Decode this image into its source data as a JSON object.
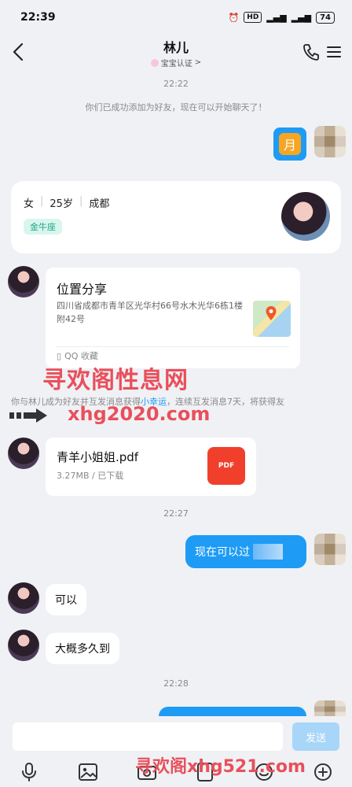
{
  "status_bar": {
    "time": "22:39",
    "battery": "74",
    "hd": "HD"
  },
  "header": {
    "title": "林儿",
    "subtitle": "宝宝认证",
    "subtitle_chevron": ">"
  },
  "timestamps": [
    "22:22",
    "22:27",
    "22:28"
  ],
  "system_messages": {
    "added_friend": "你们已成功添加为好友，现在可以开始聊天了！",
    "lucky_prefix": "你与林儿成为好友并互发消息获得",
    "lucky_link": "小幸运",
    "lucky_suffix": "，连续互发消息7天，将获得友"
  },
  "messages": {
    "emoji_label": "月",
    "mine_1": "现在可以过",
    "her_1": "可以",
    "her_2": "大概多久到"
  },
  "profile_card": {
    "gender": "女",
    "age": "25岁",
    "city": "成都",
    "zodiac_tag": "金牛座"
  },
  "location_card": {
    "title": "位置分享",
    "address": "四川省成都市青羊区光华村66号水木光华6栋1楼附42号",
    "footer": "QQ 收藏"
  },
  "file_card": {
    "name": "青羊小姐姐.pdf",
    "meta": "3.27MB / 已下载",
    "icon_text": "PDF"
  },
  "input": {
    "placeholder": "",
    "send_label": "发送"
  },
  "watermarks": {
    "cn": "寻欢阁性息网",
    "url": "xhg2020.com",
    "bottom": "寻欢阁xhg521.com"
  },
  "colors": {
    "accent": "#1e9bf5",
    "background": "#f0f1f5",
    "tag_bg": "#d8f6ee",
    "pdf": "#f0402c"
  },
  "icons": [
    "back-icon",
    "phone-icon",
    "menu-icon",
    "microphone-icon",
    "image-icon",
    "camera-icon",
    "emoji-icon",
    "plus-icon"
  ]
}
